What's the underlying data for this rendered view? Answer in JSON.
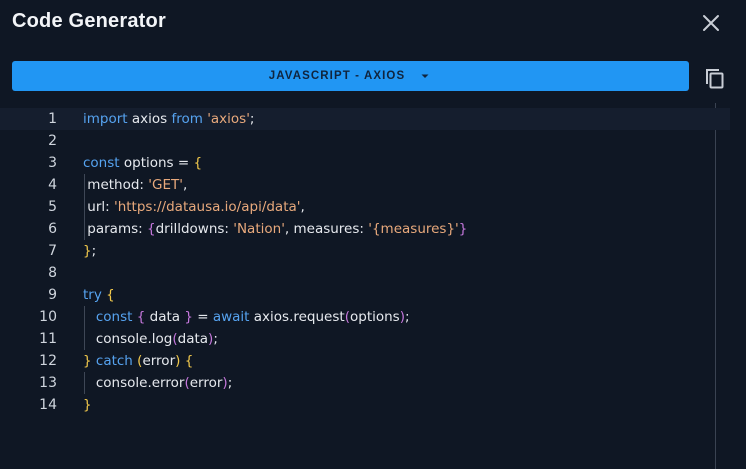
{
  "dialog": {
    "title": "Code Generator",
    "close_icon": "close-icon"
  },
  "language_selector": {
    "label": "JAVASCRIPT - AXIOS",
    "caret_icon": "caret-down-icon",
    "color": "#2196f3"
  },
  "copy_button": {
    "icon": "copy-icon"
  },
  "code": {
    "lines": [
      {
        "n": "1",
        "tokens": [
          [
            "kw",
            "import"
          ],
          [
            "plain",
            " axios "
          ],
          [
            "kw",
            "from"
          ],
          [
            "plain",
            " "
          ],
          [
            "str",
            "'axios'"
          ],
          [
            "plain",
            ";"
          ]
        ]
      },
      {
        "n": "2",
        "tokens": []
      },
      {
        "n": "3",
        "tokens": [
          [
            "kw",
            "const"
          ],
          [
            "plain",
            " options = "
          ],
          [
            "br1",
            "{"
          ]
        ]
      },
      {
        "n": "4",
        "tokens": [
          [
            "plain",
            " method: "
          ],
          [
            "str",
            "'GET'"
          ],
          [
            "plain",
            ","
          ]
        ]
      },
      {
        "n": "5",
        "tokens": [
          [
            "plain",
            " url: "
          ],
          [
            "str",
            "'https://datausa.io/api/data'"
          ],
          [
            "plain",
            ","
          ]
        ]
      },
      {
        "n": "6",
        "tokens": [
          [
            "plain",
            " params: "
          ],
          [
            "br2",
            "{"
          ],
          [
            "plain",
            "drilldowns: "
          ],
          [
            "str",
            "'Nation'"
          ],
          [
            "plain",
            ", measures: "
          ],
          [
            "str",
            "'{measures}'"
          ],
          [
            "br2",
            "}"
          ]
        ]
      },
      {
        "n": "7",
        "tokens": [
          [
            "br1",
            "}"
          ],
          [
            "plain",
            ";"
          ]
        ]
      },
      {
        "n": "8",
        "tokens": []
      },
      {
        "n": "9",
        "tokens": [
          [
            "kw",
            "try"
          ],
          [
            "plain",
            " "
          ],
          [
            "br1",
            "{"
          ]
        ]
      },
      {
        "n": "10",
        "tokens": [
          [
            "plain",
            "   "
          ],
          [
            "kw",
            "const"
          ],
          [
            "plain",
            " "
          ],
          [
            "br2",
            "{"
          ],
          [
            "plain",
            " data "
          ],
          [
            "br2",
            "}"
          ],
          [
            "plain",
            " = "
          ],
          [
            "kw",
            "await"
          ],
          [
            "plain",
            " axios.request"
          ],
          [
            "br2",
            "("
          ],
          [
            "plain",
            "options"
          ],
          [
            "br2",
            ")"
          ],
          [
            "plain",
            ";"
          ]
        ]
      },
      {
        "n": "11",
        "tokens": [
          [
            "plain",
            "   console.log"
          ],
          [
            "br2",
            "("
          ],
          [
            "plain",
            "data"
          ],
          [
            "br2",
            ")"
          ],
          [
            "plain",
            ";"
          ]
        ]
      },
      {
        "n": "12",
        "tokens": [
          [
            "br1",
            "}"
          ],
          [
            "plain",
            " "
          ],
          [
            "kw",
            "catch"
          ],
          [
            "plain",
            " "
          ],
          [
            "br1",
            "("
          ],
          [
            "plain",
            "error"
          ],
          [
            "br1",
            ")"
          ],
          [
            "plain",
            " "
          ],
          [
            "br1",
            "{"
          ]
        ]
      },
      {
        "n": "13",
        "tokens": [
          [
            "plain",
            "   console.error"
          ],
          [
            "br2",
            "("
          ],
          [
            "plain",
            "error"
          ],
          [
            "br2",
            ")"
          ],
          [
            "plain",
            ";"
          ]
        ]
      },
      {
        "n": "14",
        "tokens": [
          [
            "br1",
            "}"
          ]
        ]
      }
    ],
    "active_line": 1,
    "colors": {
      "keyword": "#56a3f0",
      "string": "#e8a97c",
      "bracket_level1": "#f2c94c",
      "bracket_level2": "#c678dd"
    }
  }
}
